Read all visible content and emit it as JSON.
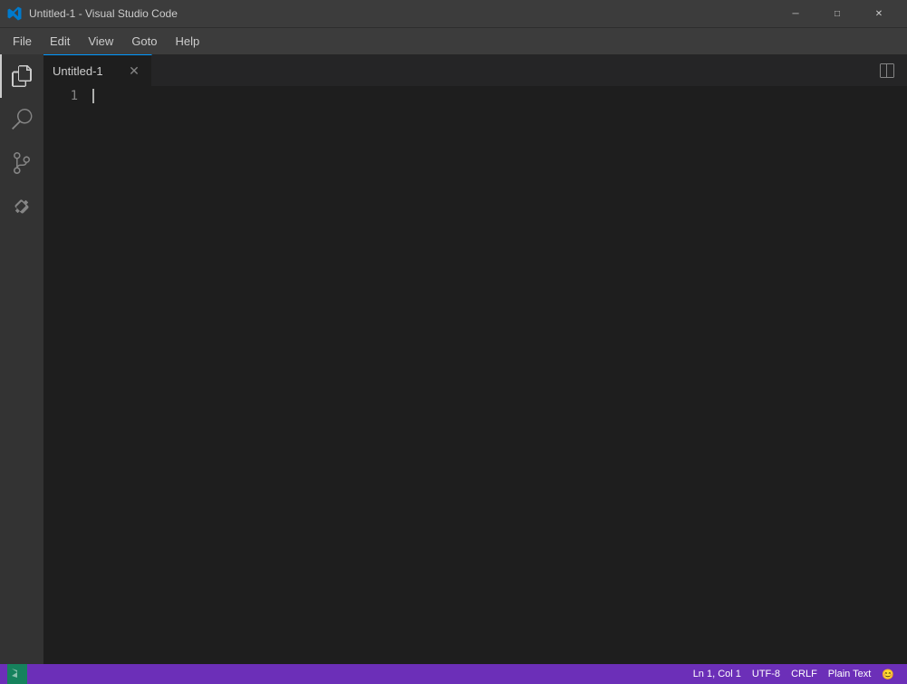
{
  "titleBar": {
    "title": "Untitled-1 - Visual Studio Code",
    "appIconAlt": "VSCode Icon"
  },
  "menuBar": {
    "items": [
      "File",
      "Edit",
      "View",
      "Goto",
      "Help"
    ]
  },
  "activityBar": {
    "icons": [
      {
        "name": "explorer-icon",
        "symbol": "📄",
        "active": true
      },
      {
        "name": "search-icon",
        "symbol": "🔍",
        "active": false
      },
      {
        "name": "source-control-icon",
        "symbol": "⑃",
        "active": false
      },
      {
        "name": "extensions-icon",
        "symbol": "⊞",
        "active": false
      }
    ]
  },
  "tabs": [
    {
      "label": "Untitled-1",
      "active": true
    }
  ],
  "editor": {
    "lineNumbers": [
      "1"
    ],
    "content": ""
  },
  "statusBar": {
    "right": [
      {
        "name": "cursor-position",
        "label": "Ln 1, Col 1"
      },
      {
        "name": "encoding",
        "label": "UTF-8"
      },
      {
        "name": "line-ending",
        "label": "CRLF"
      },
      {
        "name": "language-mode",
        "label": "Plain Text"
      }
    ],
    "feedbackIcon": "😊"
  },
  "windowControls": {
    "minimize": "─",
    "maximize": "□",
    "close": "✕"
  }
}
